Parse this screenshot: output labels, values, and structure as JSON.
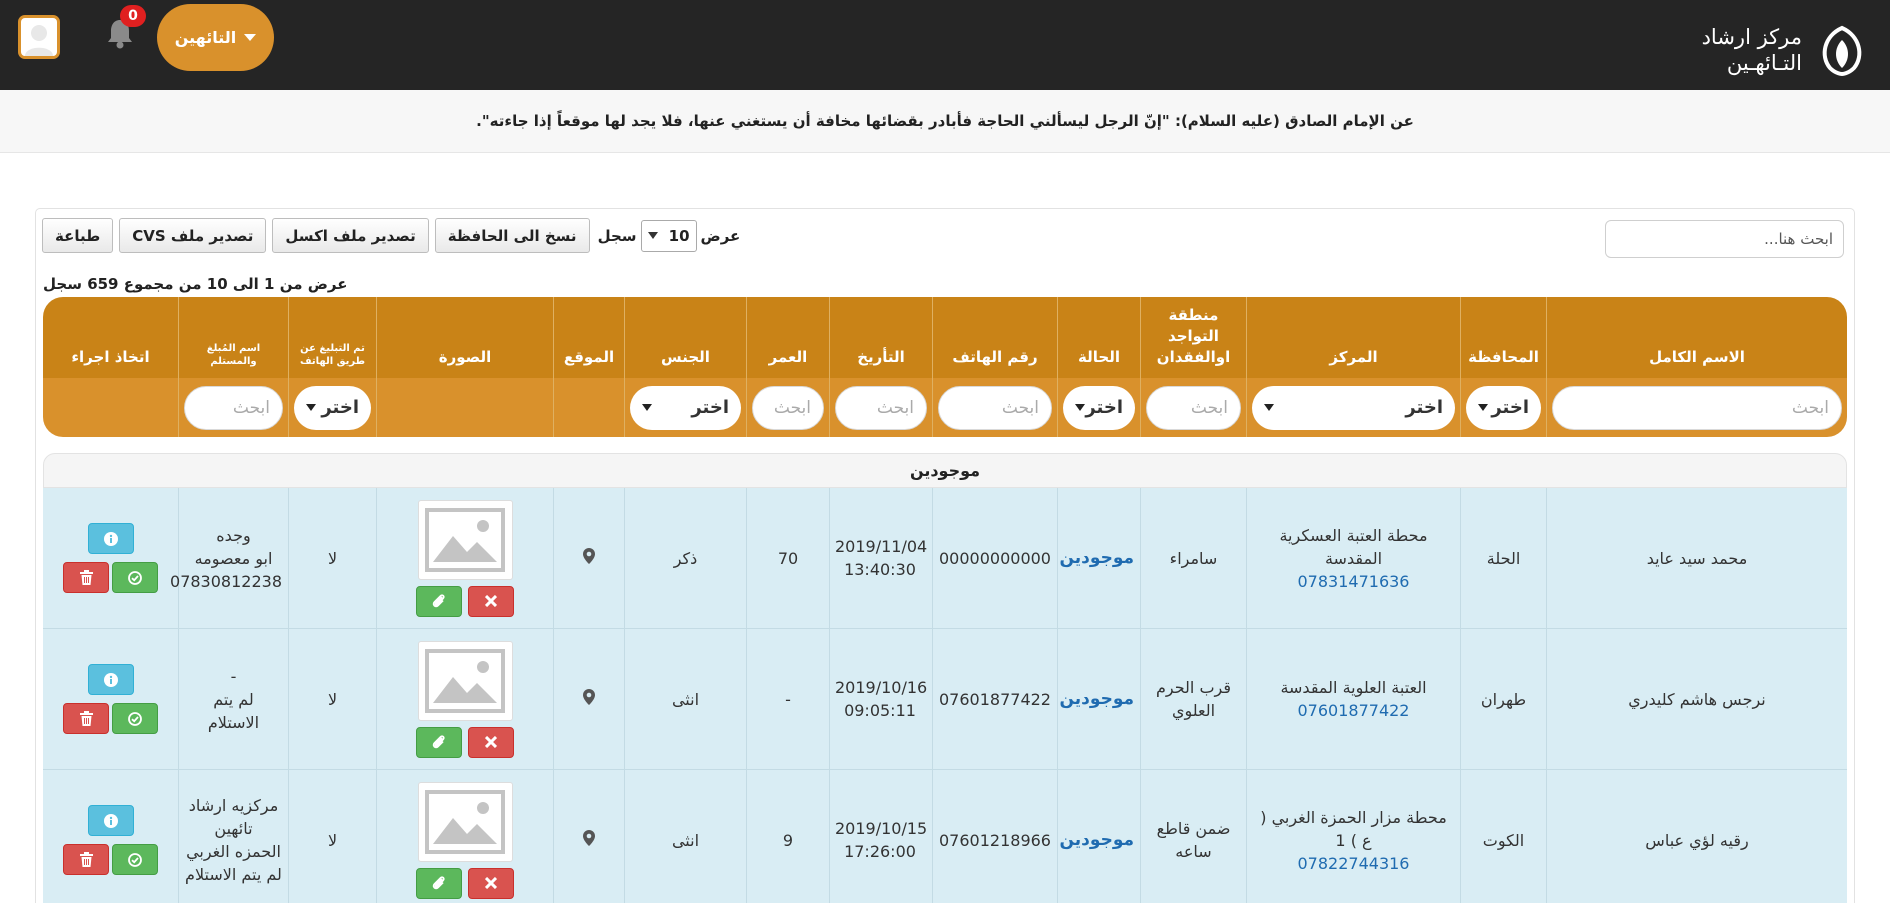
{
  "app": {
    "logo_line1": "مركز ارشاد",
    "logo_line2": "التـائهـين",
    "user_menu_label": "التائهين",
    "notifications_count": "0"
  },
  "quote": "عن الإمام الصادق (عليه السلام): \"إنّ الرجل ليسألني الحاجة فأبادر بقضائها مخافة أن يستغني عنها، فلا يجد لها موقعاً إذا جاءته\".",
  "toolbar": {
    "search_placeholder": "ابحث هنا...",
    "length_prefix": "عرض",
    "length_value": "10",
    "length_suffix": "سجل",
    "copy_label": "نسخ الى الحافظة",
    "excel_label": "تصدير ملف اكسل",
    "csv_label": "تصدير ملف CVS",
    "print_label": "طباعة"
  },
  "table_info": "عرض من 1 الى 10 من مجموع 659 سجل",
  "columns": {
    "full_name": "الاسم الكامل",
    "province": "المحافظة",
    "center": "المركز",
    "region": "منطقة التواجد اوالفقدان",
    "status": "الحالة",
    "phone": "رقم الهاتف",
    "date": "التأريخ",
    "age": "العمر",
    "gender": "الجنس",
    "location": "الموقع",
    "photo": "الصورة",
    "phone_notified": "تم التبليغ عن طريق الهاتف",
    "reporter_receiver": "اسم المُبلغ والمستلم",
    "action": "اتخاذ اجراء"
  },
  "filters": {
    "search_placeholder": "ابحث",
    "select_label": "اختر"
  },
  "group_label": "موجودين",
  "rows": [
    {
      "name": "محمد سيد عايد",
      "province": "الحلة",
      "center_name": "محطة العتبة العسكرية المقدسة",
      "center_phone": "07831471636",
      "region": "سامراء",
      "status": "موجودين",
      "phone": "00000000000",
      "date": "2019/11/04",
      "time": "13:40:30",
      "age": "70",
      "gender": "ذكر",
      "notified": "لا",
      "reporter_line1": "وجده",
      "reporter_line2": "ابو معصومه",
      "reporter_line3": "07830812238"
    },
    {
      "name": "نرجس هاشم كليدري",
      "province": "طهران",
      "center_name": "العتبة العلوية المقدسة",
      "center_phone": "07601877422",
      "region": "قرب الحرم العلوي",
      "status": "موجودين",
      "phone": "07601877422",
      "date": "2019/10/16",
      "time": "09:05:11",
      "age": "-",
      "gender": "انثى",
      "notified": "لا",
      "reporter_line1": "-",
      "reporter_line2": "لم يتم",
      "reporter_line3": "الاستلام"
    },
    {
      "name": "رقيه لؤي عباس",
      "province": "الكوت",
      "center_name": "محطة مزار الحمزة الغربي ( ع ) 1",
      "center_phone": "07822744316",
      "region": "ضمن قاطع ساعه",
      "status": "موجودين",
      "phone": "07601218966",
      "date": "2019/10/15",
      "time": "17:26:00",
      "age": "9",
      "gender": "انثى",
      "notified": "لا",
      "reporter_line1": "مركزيه ارشاد تائهين",
      "reporter_line2": "الحمزه الغربي",
      "reporter_line3": "لم يتم الاستلام"
    }
  ],
  "colors": {
    "navbar_bg": "#252525",
    "accent_orange": "#d9912c",
    "header_orange": "#c98317",
    "row_bg": "#d9edf4",
    "link_blue": "#1f6bb0"
  }
}
